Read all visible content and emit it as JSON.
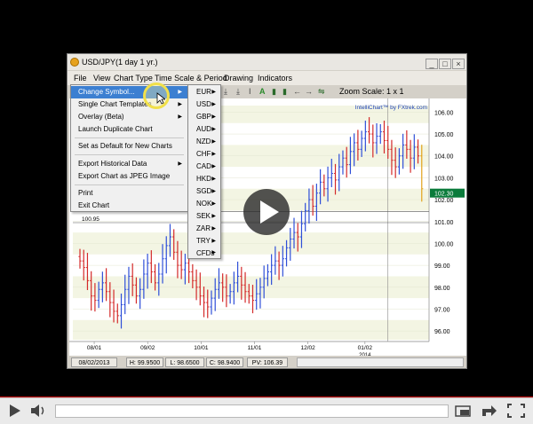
{
  "window": {
    "title": "USD/JPY(1 day  1 yr.)",
    "buttons": [
      "_",
      "□",
      "×"
    ]
  },
  "menubar": [
    "File",
    "View",
    "Chart Type",
    "Time Scale & Period",
    "Drawing",
    "Indicators"
  ],
  "toolbar": {
    "zoom_label": "Zoom Scale: 1 x 1"
  },
  "file_menu": {
    "items": [
      {
        "label": "Change Symbol...",
        "submenu": true,
        "highlighted": true
      },
      {
        "label": "Single Chart Templates",
        "submenu": true
      },
      {
        "label": "Overlay (Beta)",
        "submenu": true
      },
      {
        "label": "Launch Duplicate Chart",
        "submenu": false
      },
      {
        "label": "Set as Default for New Charts",
        "submenu": false
      },
      {
        "label": "Export Historical Data",
        "submenu": true
      },
      {
        "label": "Export Chart as JPEG Image",
        "submenu": false
      },
      {
        "label": "Print",
        "submenu": false
      },
      {
        "label": "Exit Chart",
        "submenu": false
      }
    ]
  },
  "symbol_menu": {
    "items": [
      "EUR",
      "USD",
      "GBP",
      "AUD",
      "NZD",
      "CHF",
      "CAD",
      "HKD",
      "SGD",
      "NOK",
      "SEK",
      "ZAR",
      "TRY",
      "CFDs"
    ]
  },
  "chart_data": {
    "type": "bar",
    "series_style": "ohlc",
    "brand_label": "IntelliChart™ by FXtrek.com",
    "y_ticks": [
      96.0,
      97.0,
      98.0,
      99.0,
      100.0,
      101.0,
      102.0,
      103.0,
      104.0,
      105.0,
      106.0
    ],
    "y_tick_labels": [
      "96.00",
      "97.00",
      "98.00",
      "99.00",
      "100.00",
      "101.00",
      "102.00",
      "103.00",
      "104.00",
      "105.00",
      "106.00"
    ],
    "ylim": [
      95.6,
      106.3
    ],
    "x_tick_labels": [
      "08/01",
      "09/02",
      "10/01",
      "11/01",
      "12/02",
      "01/02"
    ],
    "x_sub_label": "2014",
    "current_price_label": "102.30",
    "current_price": 102.3,
    "hline_label": "100.95",
    "hline_value": 100.95,
    "hline2_value": 101.45,
    "up_color": "#2f4fd8",
    "down_color": "#d42a2a",
    "last_color": "#e2a21a",
    "price_tag_color": "#0b7b3b",
    "closes": [
      99.2,
      98.9,
      98.3,
      97.6,
      97.4,
      97.9,
      98.2,
      97.8,
      97.3,
      96.9,
      96.7,
      97.2,
      97.9,
      98.5,
      98.1,
      97.6,
      97.9,
      98.6,
      99.1,
      98.7,
      98.2,
      98.6,
      99.3,
      99.9,
      100.3,
      99.6,
      99.0,
      98.8,
      99.1,
      98.7,
      98.3,
      98.0,
      97.6,
      97.3,
      97.1,
      97.5,
      97.9,
      98.2,
      98.0,
      97.6,
      97.8,
      98.2,
      98.5,
      98.1,
      97.8,
      97.6,
      97.4,
      97.7,
      98.0,
      98.4,
      98.7,
      99.0,
      99.2,
      99.0,
      99.3,
      99.8,
      100.2,
      100.5,
      100.3,
      100.9,
      101.5,
      102.0,
      101.7,
      102.3,
      102.8,
      102.5,
      103.0,
      103.2,
      102.9,
      103.5,
      103.9,
      103.6,
      104.2,
      104.6,
      104.3,
      104.8,
      105.1,
      105.0,
      104.6,
      104.9,
      105.1,
      104.7,
      104.3,
      103.8,
      103.5,
      104.0,
      104.5,
      104.3,
      103.9,
      104.4,
      104.0,
      102.5
    ]
  },
  "status": {
    "date": "08/02/2013",
    "high": "H: 99.9500",
    "low": "L: 98.6500",
    "close": "C: 98.9400",
    "pv": "PV: 106.39"
  }
}
